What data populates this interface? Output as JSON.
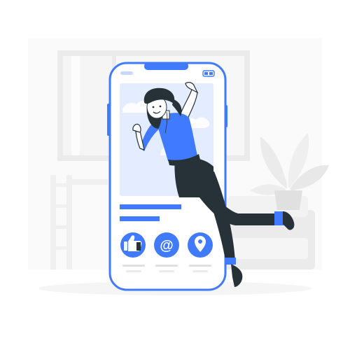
{
  "illustration": {
    "subject": "person-emerging-from-smartphone",
    "colors": {
      "accent": "#407BFF",
      "accent_light": "#C9D8FF",
      "screen_bg": "#E4ECFF",
      "phone_body": "#FFFFFF",
      "background_shapes": "#F5F5F5",
      "background_shapes_dark": "#EBEBEB",
      "hair_and_pants": "#263238",
      "skin": "#FFFFFF"
    }
  },
  "phone": {
    "status_icon": "battery-icon",
    "content_lines": [
      {
        "fraction": 1.0
      },
      {
        "fraction": 0.6
      }
    ],
    "action_buttons": [
      {
        "icon": "thumbs-up-icon",
        "glyph": ""
      },
      {
        "icon": "at-sign-icon",
        "glyph": "@"
      },
      {
        "icon": "location-pin-icon",
        "glyph": ""
      }
    ]
  }
}
